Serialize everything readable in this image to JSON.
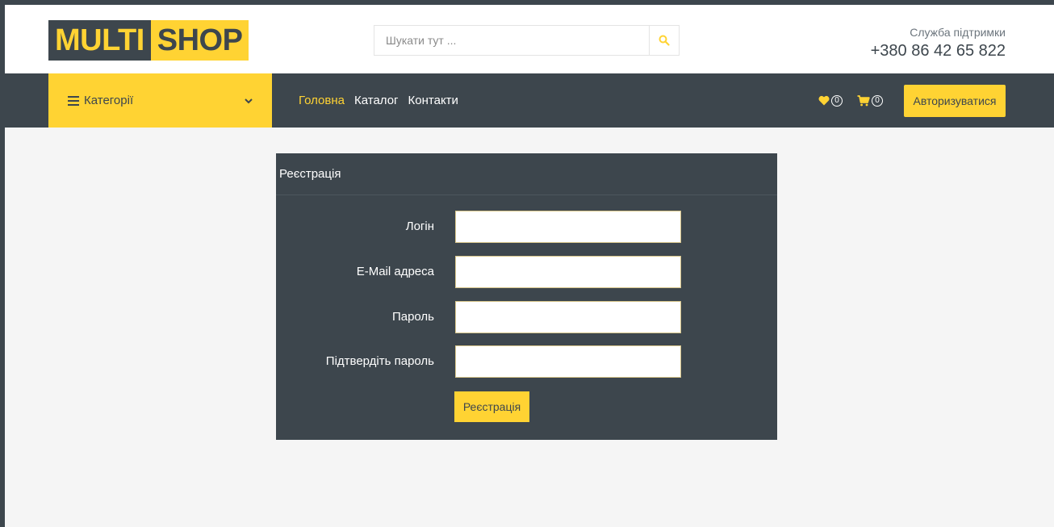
{
  "header": {
    "logo": {
      "part1": "MULTI",
      "part2": "SHOP"
    },
    "search": {
      "placeholder": "Шукати тут ...",
      "icon": "search-icon"
    },
    "support": {
      "label": "Служба підтримки",
      "phone": "+380 86 42 65 822"
    }
  },
  "nav": {
    "categories_label": "Категорії",
    "links": [
      {
        "label": "Головна",
        "active": true
      },
      {
        "label": "Каталог",
        "active": false
      },
      {
        "label": "Контакти",
        "active": false
      }
    ],
    "wishlist_count": "0",
    "cart_count": "0",
    "login_label": "Авторизуватися"
  },
  "form": {
    "title": "Реєстрація",
    "fields": [
      {
        "label": "Логін",
        "value": ""
      },
      {
        "label": "E-Mail адреса",
        "value": ""
      },
      {
        "label": "Пароль",
        "value": ""
      },
      {
        "label": "Підтвердіть пароль",
        "value": ""
      }
    ],
    "submit_label": "Реєстрація"
  },
  "colors": {
    "accent": "#ffd333",
    "dark": "#3d464d",
    "background": "#f5f5f5"
  }
}
